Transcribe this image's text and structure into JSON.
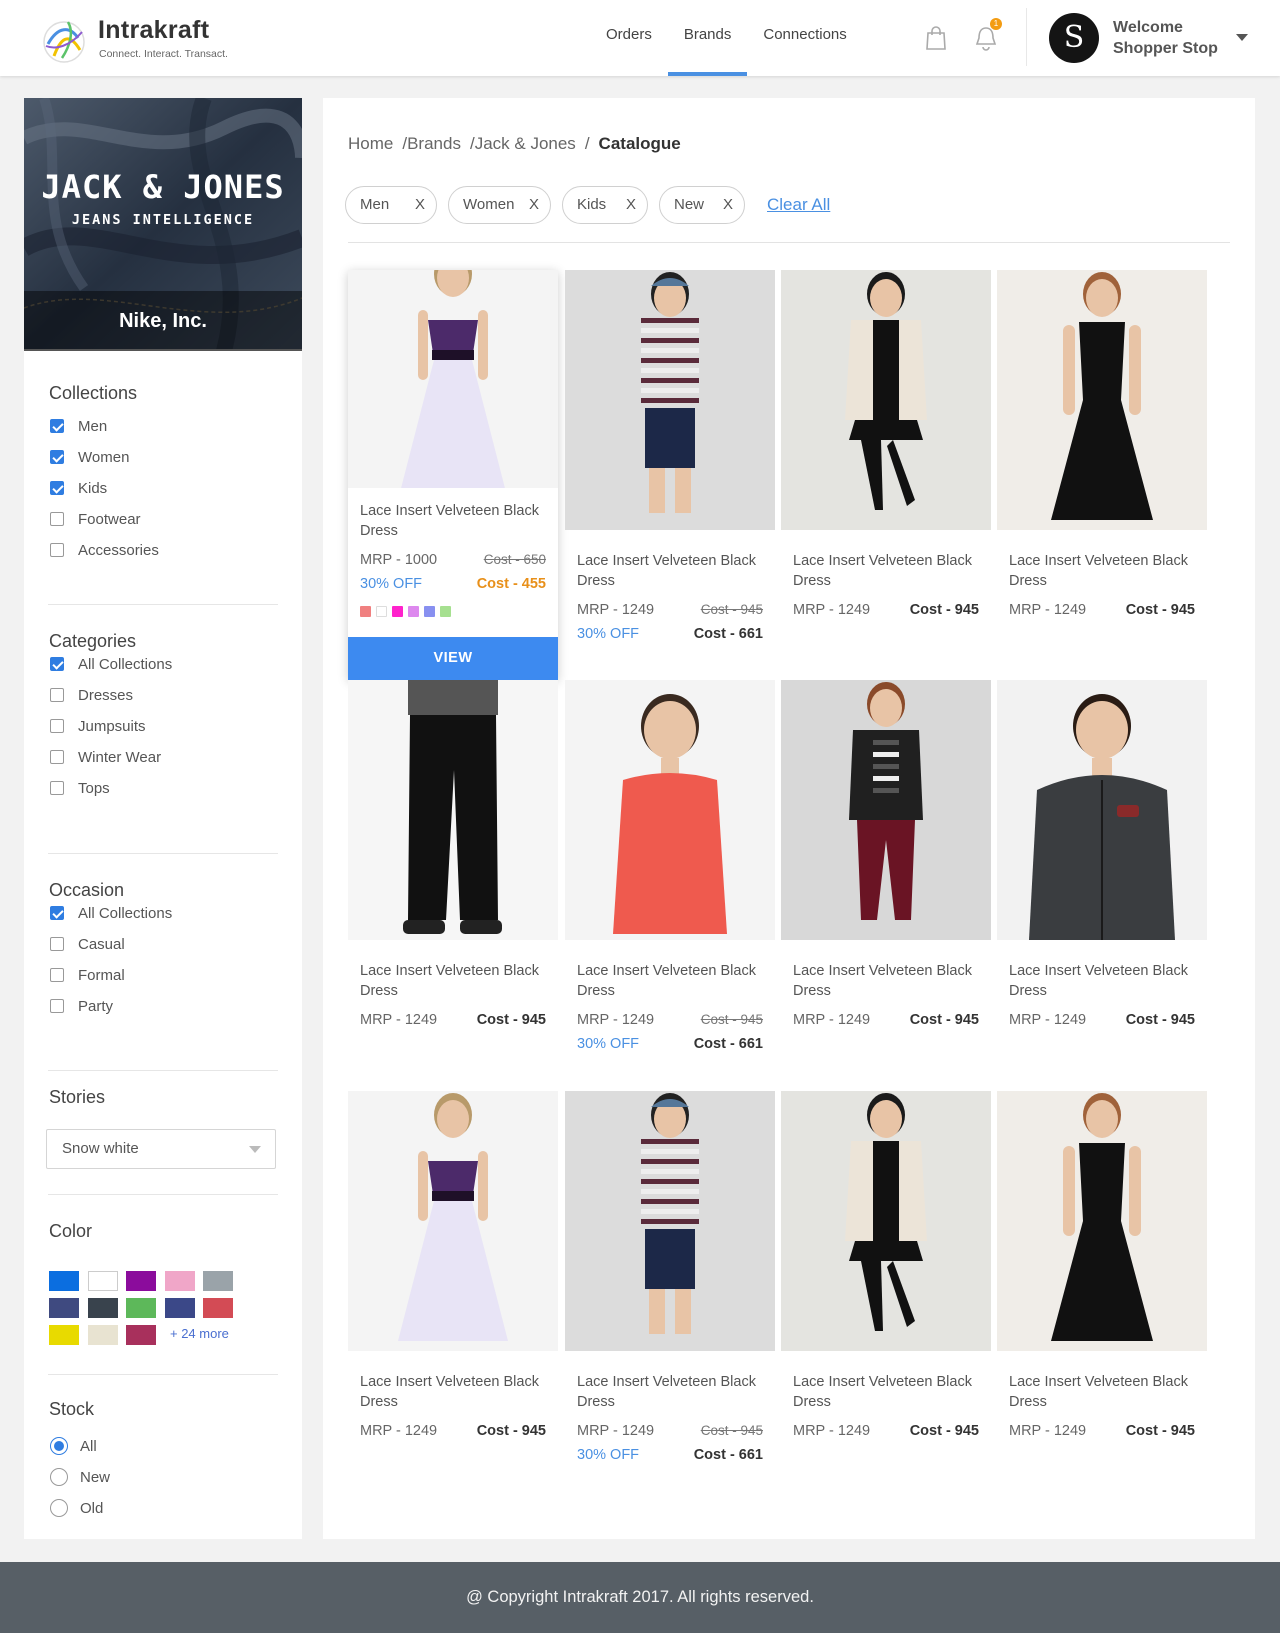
{
  "header": {
    "brand": "Intrakraft",
    "tagline": "Connect. Interact. Transact.",
    "nav": [
      "Orders",
      "Brands",
      "Connections"
    ],
    "active_nav": "Brands",
    "notification_count": "1",
    "avatar_letter": "S",
    "welcome_line1": "Welcome",
    "welcome_line2": "Shopper Stop"
  },
  "sidebar": {
    "banner": {
      "title": "JACK & JONES",
      "subtitle": "JEANS INTELLIGENCE",
      "caption": "Nike, Inc."
    },
    "collections": {
      "title": "Collections",
      "items": [
        {
          "label": "Men",
          "checked": true
        },
        {
          "label": "Women",
          "checked": true
        },
        {
          "label": "Kids",
          "checked": true
        },
        {
          "label": "Footwear",
          "checked": false
        },
        {
          "label": "Accessories",
          "checked": false
        }
      ]
    },
    "categories": {
      "title": "Categories",
      "items": [
        {
          "label": "All Collections",
          "checked": true
        },
        {
          "label": "Dresses",
          "checked": false
        },
        {
          "label": "Jumpsuits",
          "checked": false
        },
        {
          "label": "Winter Wear",
          "checked": false
        },
        {
          "label": "Tops",
          "checked": false
        }
      ]
    },
    "occasion": {
      "title": "Occasion",
      "items": [
        {
          "label": "All Collections",
          "checked": true
        },
        {
          "label": "Casual",
          "checked": false
        },
        {
          "label": "Formal",
          "checked": false
        },
        {
          "label": "Party",
          "checked": false
        }
      ]
    },
    "stories": {
      "title": "Stories",
      "selected": "Snow white"
    },
    "color": {
      "title": "Color",
      "swatches": [
        "#0b6ee0",
        "#ffffff",
        "#8b0c9c",
        "#f0a6c8",
        "#9aa3a9",
        "#3f4a80",
        "#39434d",
        "#5db85a",
        "#3b4888",
        "#d34b55",
        "#e8da00",
        "#e8e3d1",
        "#a8305c"
      ],
      "more": "+ 24 more"
    },
    "stock": {
      "title": "Stock",
      "items": [
        {
          "label": "All",
          "checked": true
        },
        {
          "label": "New",
          "checked": false
        },
        {
          "label": "Old",
          "checked": false
        }
      ]
    }
  },
  "main": {
    "breadcrumb": [
      "Home",
      "Brands",
      "Jack & Jones",
      "Catalogue"
    ],
    "chips": [
      "Men",
      "Women",
      "Kids",
      "New"
    ],
    "chip_close": "X",
    "clear_all": "Clear All",
    "view_label": "VIEW",
    "products": [
      {
        "type": "kid",
        "name": "Lace Insert Velveteen Black Dress",
        "mrp": "MRP - 1000",
        "old_cost": "Cost - 650",
        "discount": "30% OFF",
        "cost": "Cost - 455",
        "highlight": true,
        "dot_colors": [
          "#f08080",
          "#ffffff",
          "#ff22cc",
          "#dd88ee",
          "#8890f0",
          "#a6e090"
        ]
      },
      {
        "type": "stripe",
        "name": "Lace Insert Velveteen Black Dress",
        "mrp": "MRP - 1249",
        "old_cost": "Cost - 945",
        "discount": "30% OFF",
        "cost": "Cost - 661"
      },
      {
        "type": "jacket",
        "name": "Lace Insert Velveteen Black Dress",
        "mrp": "MRP - 1249",
        "cost": "Cost - 945"
      },
      {
        "type": "black",
        "name": "Lace Insert Velveteen Black Dress",
        "mrp": "MRP - 1249",
        "cost": "Cost - 945"
      },
      {
        "type": "jeans",
        "name": "Lace Insert Velveteen Black Dress",
        "mrp": "MRP - 1249",
        "cost": "Cost - 945"
      },
      {
        "type": "red",
        "name": "Lace Insert Velveteen Black Dress",
        "mrp": "MRP - 1249",
        "old_cost": "Cost - 945",
        "discount": "30% OFF",
        "cost": "Cost - 661"
      },
      {
        "type": "leather",
        "name": "Lace Insert Velveteen Black Dress",
        "mrp": "MRP - 1249",
        "cost": "Cost - 945"
      },
      {
        "type": "man",
        "name": "Lace Insert Velveteen Black Dress",
        "mrp": "MRP - 1249",
        "cost": "Cost - 945"
      },
      {
        "type": "kid",
        "name": "Lace Insert Velveteen Black Dress",
        "mrp": "MRP - 1249",
        "cost": "Cost - 945"
      },
      {
        "type": "stripe",
        "name": "Lace Insert Velveteen Black Dress",
        "mrp": "MRP - 1249",
        "old_cost": "Cost - 945",
        "discount": "30% OFF",
        "cost": "Cost - 661"
      },
      {
        "type": "jacket",
        "name": "Lace Insert Velveteen Black Dress",
        "mrp": "MRP - 1249",
        "cost": "Cost - 945"
      },
      {
        "type": "black",
        "name": "Lace Insert Velveteen Black Dress",
        "mrp": "MRP - 1249",
        "cost": "Cost - 945"
      }
    ]
  },
  "footer": {
    "copyright": "@ Copyright Intrakraft 2017. All rights reserved."
  }
}
